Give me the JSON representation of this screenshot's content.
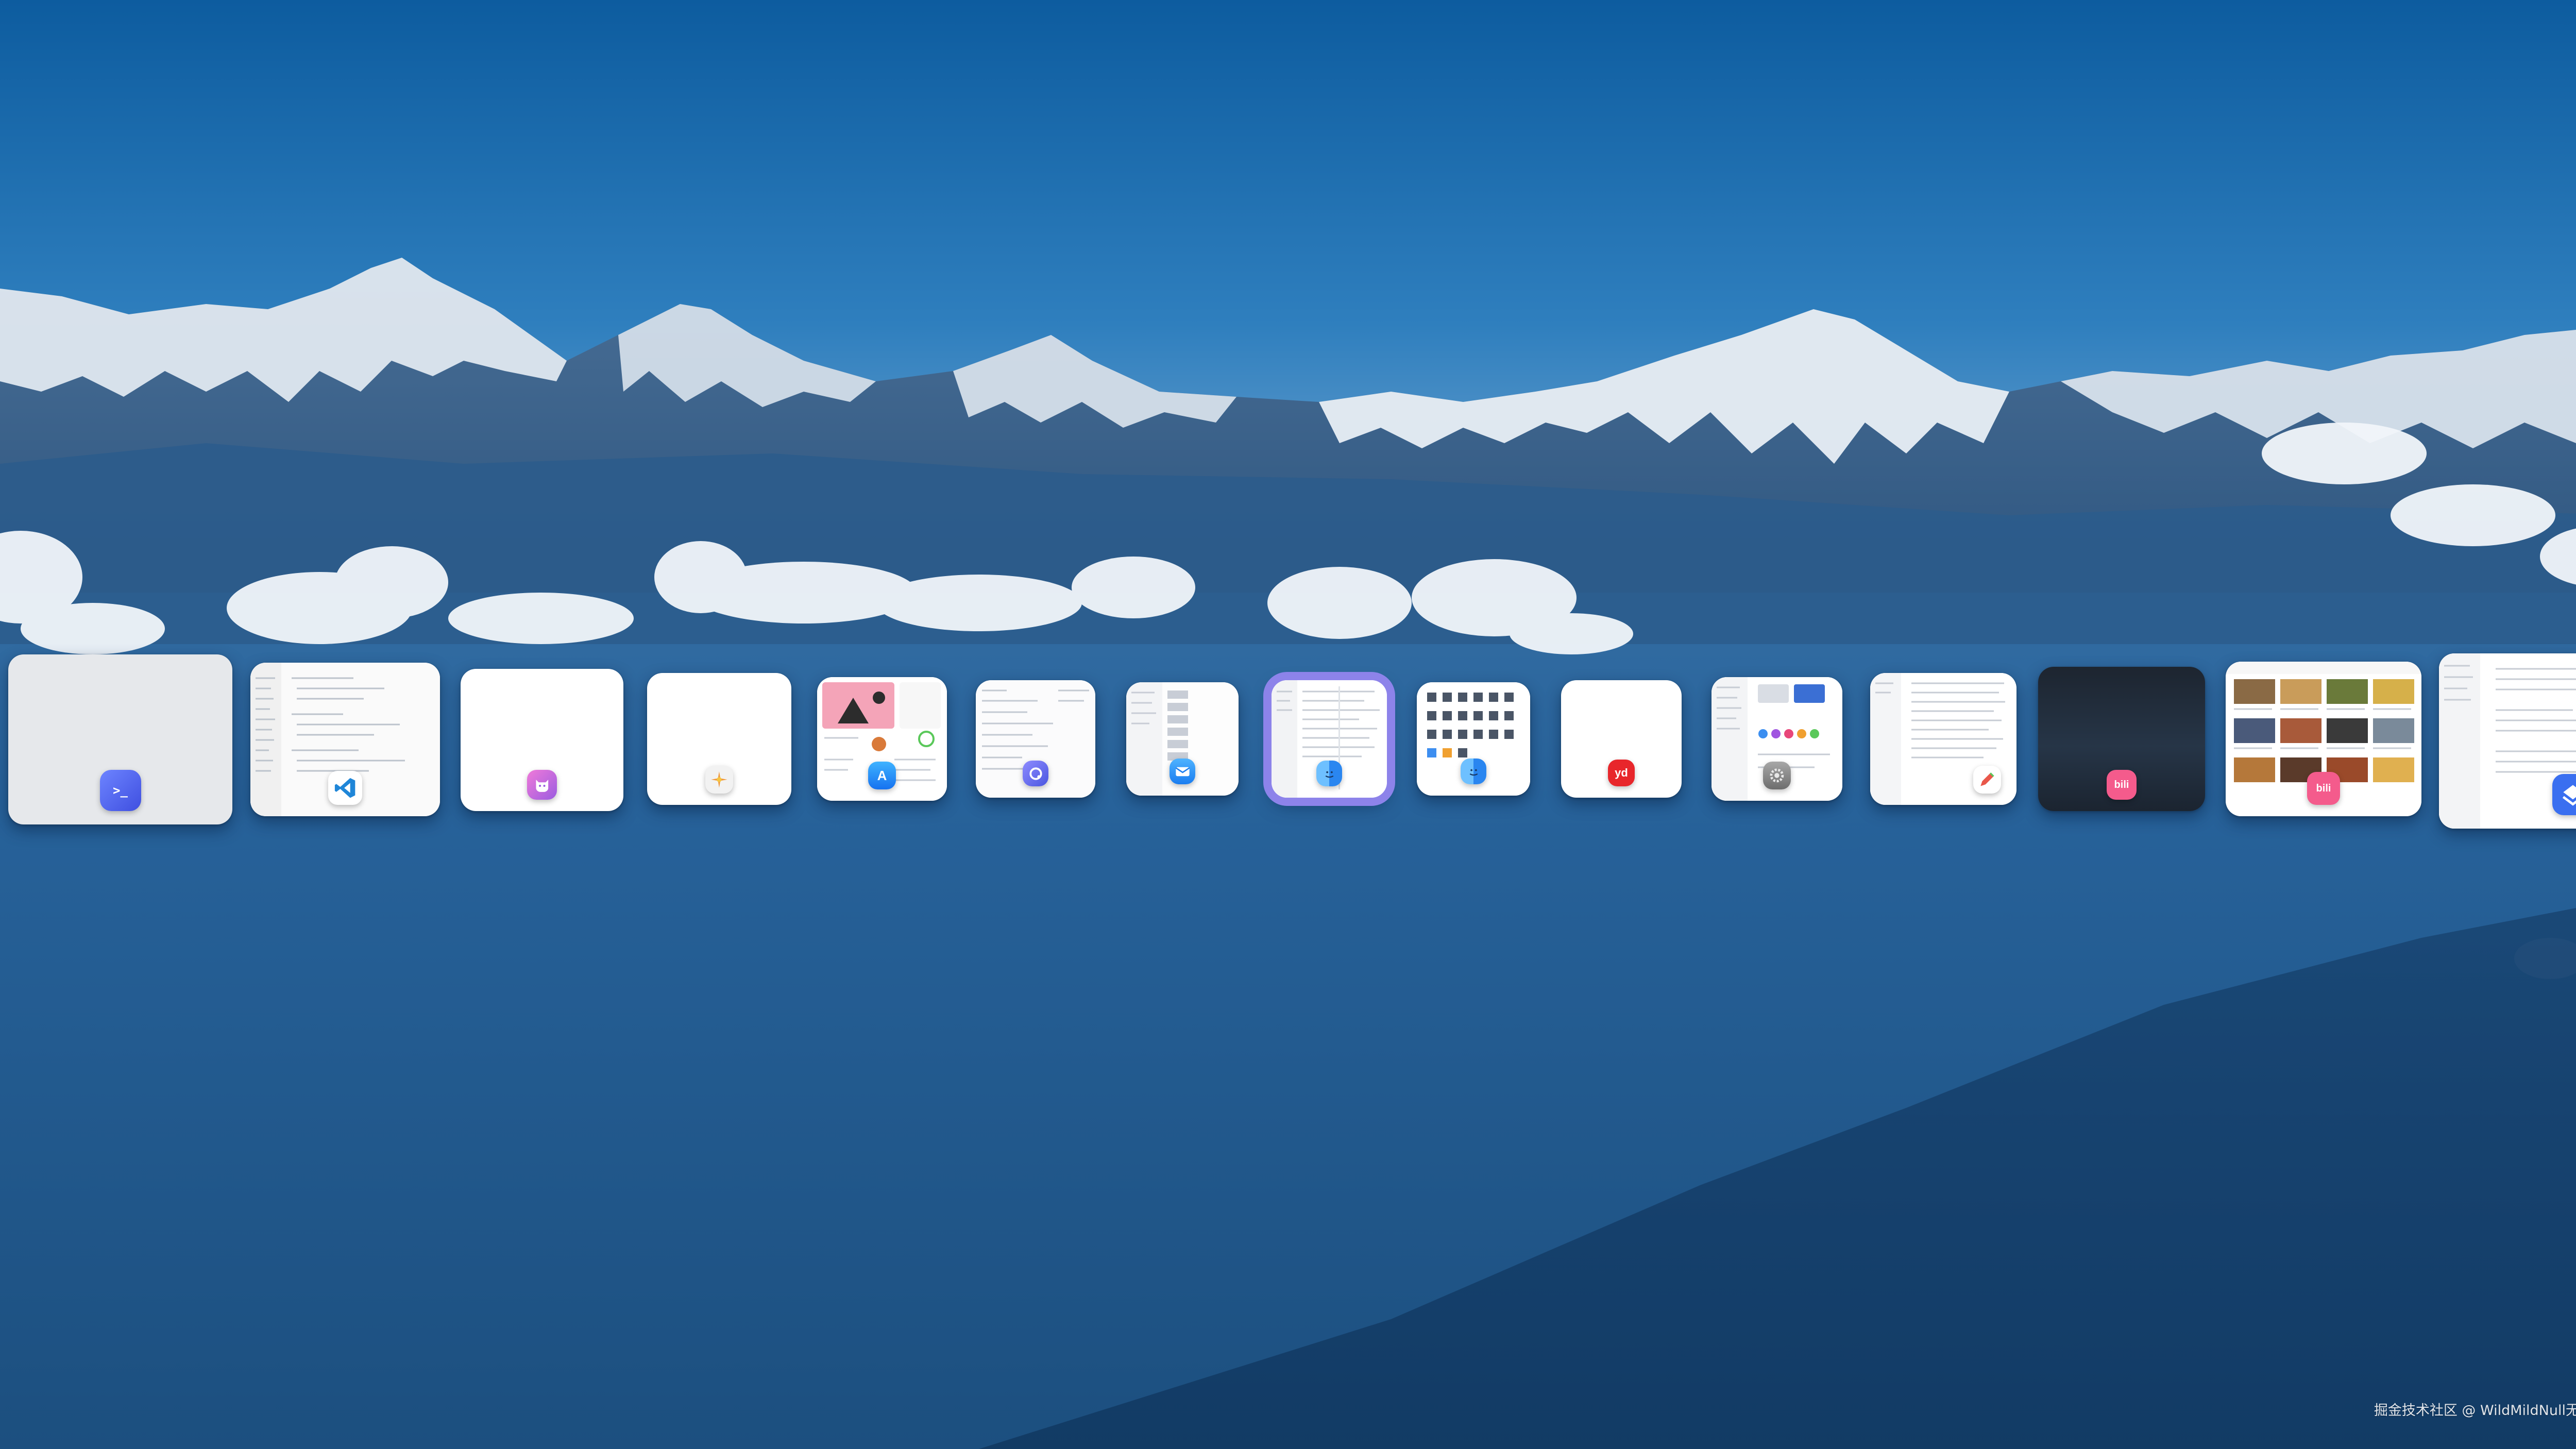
{
  "wallpaper": {
    "description_colors": {
      "sky_top": "#0f5fa3",
      "sky_horizon": "#3d87c4",
      "valley": "#1f5686"
    }
  },
  "app_switcher": {
    "selected_index": 7,
    "accent_color": "#8d83ea",
    "windows": [
      {
        "name": "terminal-window",
        "icon": "terminal-icon",
        "icon_label": ">_",
        "icon_color": "#4f6cf0"
      },
      {
        "name": "vscode-window",
        "icon": "vscode-icon",
        "icon_label": "",
        "icon_color": "#1f86d8"
      },
      {
        "name": "runcat-window",
        "icon": "cat-icon",
        "icon_label": "",
        "icon_color": "#c45cd9"
      },
      {
        "name": "pixelmator-window",
        "icon": "sparkle-icon",
        "icon_label": "",
        "icon_color": "#e6a35c"
      },
      {
        "name": "app-store-window",
        "icon": "app-store-icon",
        "icon_label": "A",
        "icon_color": "#1f8ef5"
      },
      {
        "name": "arc-window",
        "icon": "arc-icon",
        "icon_label": "",
        "icon_color": "#6f6ef0"
      },
      {
        "name": "mail-window",
        "icon": "mail-icon",
        "icon_label": "",
        "icon_color": "#2e9bf5"
      },
      {
        "name": "finder-window",
        "icon": "finder-icon",
        "icon_label": "",
        "icon_color": "#2d8ff0"
      },
      {
        "name": "finder-grid-window",
        "icon": "finder-icon",
        "icon_label": "",
        "icon_color": "#2d8ff0"
      },
      {
        "name": "youdao-window",
        "icon": "youdao-icon",
        "icon_label": "yd",
        "icon_color": "#e8262b"
      },
      {
        "name": "settings-window",
        "icon": "gear-icon",
        "icon_label": "",
        "icon_color": "#8c8c8c"
      },
      {
        "name": "document-window",
        "icon": "pencil-icon",
        "icon_label": "",
        "icon_color": "#e9574a"
      },
      {
        "name": "bilibili-player-window",
        "icon": "bilibili-icon",
        "icon_label": "bili",
        "icon_color": "#f45b8c"
      },
      {
        "name": "bilibili-feed-window",
        "icon": "bilibili-icon",
        "icon_label": "bili",
        "icon_color": "#f45b8c"
      },
      {
        "name": "feishu-window",
        "icon": "feishu-icon",
        "icon_label": "",
        "icon_color": "#3a6ff0"
      }
    ]
  },
  "watermark": {
    "text": "掘金技术社区 @ WildMildNull无为"
  }
}
